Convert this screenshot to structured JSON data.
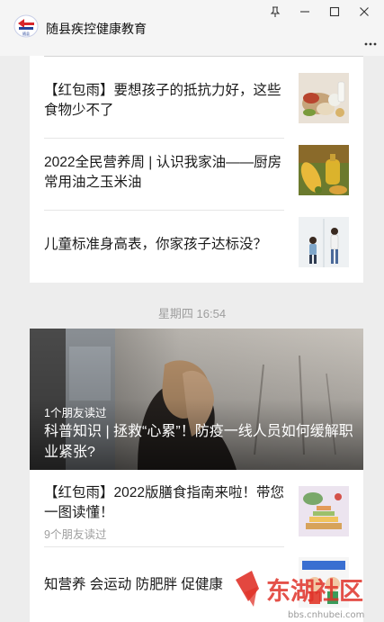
{
  "window": {
    "account_name": "随县疾控健康教育",
    "pin_icon": "pin-icon",
    "minimize_icon": "minimize-icon",
    "maximize_icon": "maximize-icon",
    "close_icon": "close-icon",
    "more_icon": "more-dots-icon"
  },
  "articles_top": [
    {
      "title": "【红包雨】要想孩子的抵抗力好，这些食物少不了",
      "thumb": "food-table-thumbnail"
    },
    {
      "title": "2022全民营养周 | 认识我家油——厨房常用油之玉米油",
      "thumb": "corn-oil-thumbnail"
    },
    {
      "title": "儿童标准身高表，你家孩子达标没？",
      "thumb": "children-height-thumbnail"
    }
  ],
  "time_label": "星期四  16:54",
  "hero": {
    "read_count": "1个朋友读过",
    "title": "科普知识 | 拯救“心累”！防疫一线人员如何缓解职业紧张?"
  },
  "articles_bottom": [
    {
      "title": "【红包雨】2022版膳食指南来啦！带您一图读懂！",
      "read_count": "9个朋友读过",
      "thumb": "dietary-pyramid-thumbnail"
    },
    {
      "title": "知营养 会运动 防肥胖 促健康",
      "thumb": "nutrition-cartoon-thumbnail"
    }
  ],
  "watermark": {
    "text": "东湖社区",
    "url": "bbs.cnhubei.com"
  },
  "colors": {
    "accent_red": "#e0332a",
    "background": "#ededed",
    "card": "#ffffff",
    "muted": "#9e9e9e"
  }
}
